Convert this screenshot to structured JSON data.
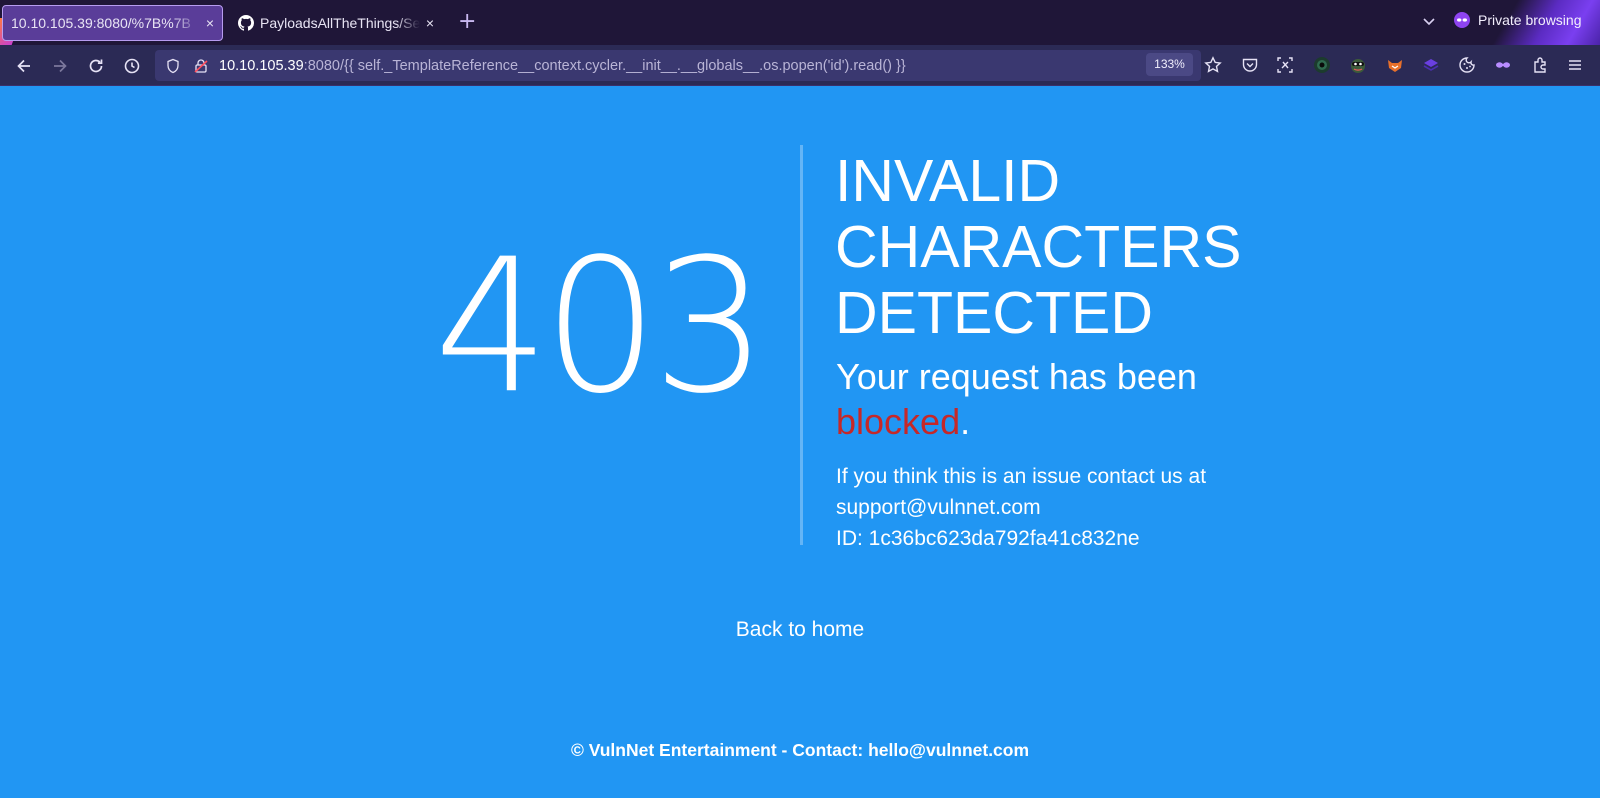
{
  "browser": {
    "tabs": [
      {
        "title": "10.10.105.39:8080/%7B%7B",
        "active": true,
        "close": "×"
      },
      {
        "title": "PayloadsAllTheThings/Se",
        "active": false,
        "close": "×"
      }
    ],
    "new_tab": "+",
    "private_label": "Private browsing",
    "url_host": "10.10.105.39",
    "url_rest": ":8080/{{ self._TemplateReference__context.cycler.__init__.__globals__.os.popen('id').read() }}",
    "zoom": "133%",
    "icons": [
      "back-icon",
      "forward-icon",
      "reload-icon",
      "history-icon",
      "shield-icon",
      "lock-icon",
      "bookmark-star-icon",
      "pocket-icon",
      "screenshot-icon",
      "extension-eye-icon",
      "extension-mask-icon",
      "extension-fox-icon",
      "extension-layers-icon",
      "cookie-icon",
      "private-mask-icon",
      "extensions-icon",
      "menu-icon"
    ],
    "colors": {
      "tabbar": "#1f1638",
      "navbar": "#2b2a55",
      "urlbar": "#3a3870",
      "active_tab": "#5a3d99"
    }
  },
  "page": {
    "code": "403",
    "headline": "INVALID CHARACTERS DETECTED",
    "subline_prefix": "Your request has been ",
    "subline_blocked": "blocked",
    "subline_suffix": ".",
    "detail_line1": "If you think this is an issue contact us at",
    "detail_line2": "support@vulnnet.com",
    "detail_line3": "ID: 1c36bc623da792fa41c832ne",
    "back_link": "Back to home",
    "footer": "© VulnNet Entertainment - Contact: hello@vulnnet.com",
    "colors": {
      "background": "#2196f3",
      "divider": "#64b5f6",
      "blocked": "#c62828",
      "text": "#ffffff"
    }
  }
}
